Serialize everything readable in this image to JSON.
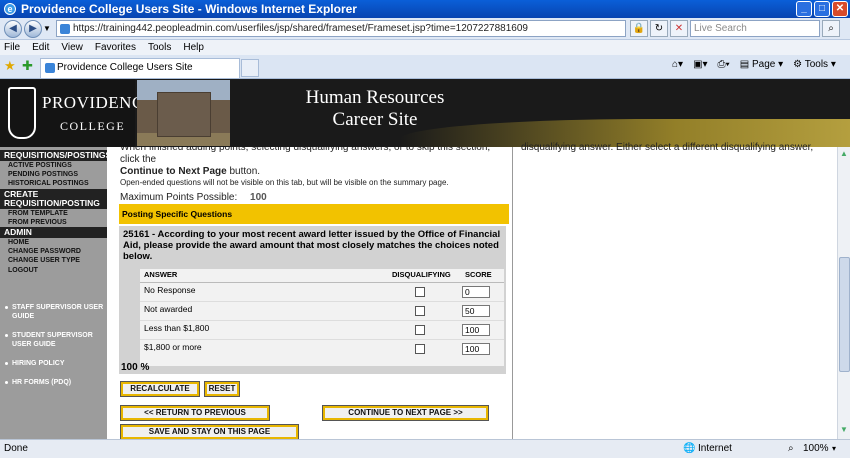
{
  "window": {
    "title": "Providence College Users Site - Windows Internet Explorer"
  },
  "address": {
    "url": "https://training442.peopleadmin.com/userfiles/jsp/shared/frameset/Frameset.jsp?time=1207227881609",
    "search_placeholder": "Live Search"
  },
  "menu": [
    "File",
    "Edit",
    "View",
    "Favorites",
    "Tools",
    "Help"
  ],
  "tab": {
    "label": "Providence College Users Site"
  },
  "toolbar": {
    "page": "Page",
    "tools": "Tools"
  },
  "header": {
    "logo_line1": "PROVIDENCE",
    "logo_line2": "COLLEGE",
    "title_line1": "Human Resources",
    "title_line2": "Career Site"
  },
  "sidebar": {
    "sections": [
      {
        "title": "REQUISITIONS/POSTINGS",
        "items": [
          "ACTIVE POSTINGS",
          "PENDING POSTINGS",
          "HISTORICAL POSTINGS"
        ]
      },
      {
        "title": "CREATE REQUISITION/POSTING",
        "items": [
          "FROM TEMPLATE",
          "FROM PREVIOUS"
        ]
      },
      {
        "title": "ADMIN",
        "items": [
          "HOME",
          "CHANGE PASSWORD",
          "CHANGE USER TYPE",
          "LOGOUT"
        ]
      }
    ],
    "guides": [
      "STAFF SUPERVISOR USER GUIDE",
      "STUDENT SUPERVISOR USER GUIDE",
      "HIRING POLICY",
      "HR FORMS (PDQ)"
    ]
  },
  "content": {
    "intro_top": "When finished adding points, selecting disqualifying answers, or to skip this section, click the",
    "intro_link": "Continue to Next Page",
    "intro_end": "button.",
    "note": "Open-ended questions will not be visible on this tab, but will be visible on the summary page.",
    "max_points_label": "Maximum Points Possible:",
    "max_points_value": "100",
    "section_title": "Posting Specific Questions",
    "question": "25161 - According to your most recent award letter issued by the Office of Financial Aid, please provide the award amount that most closely matches the choices noted below.",
    "columns": {
      "answer": "ANSWER",
      "disqualifying": "DISQUALIFYING",
      "score": "SCORE"
    },
    "answers": [
      {
        "answer": "No Response",
        "score": "0"
      },
      {
        "answer": "Not awarded",
        "score": "50"
      },
      {
        "answer": "Less than $1,800",
        "score": "100"
      },
      {
        "answer": "$1,800 or more",
        "score": "100"
      }
    ],
    "percent": "100 %",
    "buttons": {
      "recalculate": "RECALCULATE",
      "reset": "RESET",
      "return": "<< RETURN TO PREVIOUS",
      "continue": "CONTINUE TO NEXT PAGE >>",
      "save": "SAVE AND STAY ON THIS PAGE"
    }
  },
  "right_pane": {
    "text": "disqualifying answer. Either select a different disqualifying answer,"
  },
  "status": {
    "left": "Done",
    "zone": "Internet",
    "zoom": "100%"
  }
}
